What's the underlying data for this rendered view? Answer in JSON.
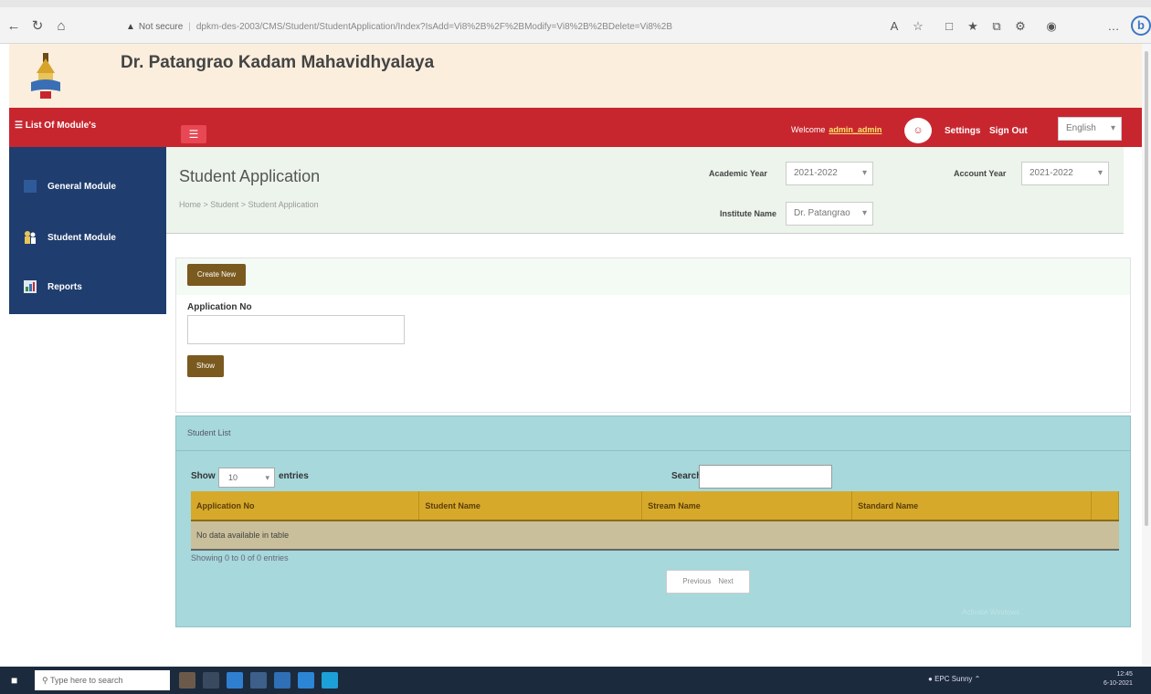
{
  "browser": {
    "not_secure": "Not secure",
    "url": "dpkm-des-2003/CMS/Student/StudentApplication/Index?IsAdd=Vi8%2B%2F%2BModify=Vi8%2B%2BDelete=Vi8%2B"
  },
  "site": {
    "title": "Dr. Patangrao Kadam Mahavidhyalaya"
  },
  "topnav": {
    "module_list": "List Of Module's",
    "welcome": "Welcome",
    "username": "admin_admin",
    "settings": "Settings",
    "sign_out": "Sign Out",
    "language": "English"
  },
  "sidebar": {
    "items": [
      {
        "label": "General Module"
      },
      {
        "label": "Student Module"
      },
      {
        "label": "Reports"
      }
    ]
  },
  "header": {
    "title": "Student Application",
    "breadcrumb": "Home > Student > Student Application",
    "academic_year_label": "Academic Year",
    "academic_year_value": "2021-2022",
    "account_year_label": "Account Year",
    "account_year_value": "2021-2022",
    "institute_label": "Institute Name",
    "institute_value": "Dr. Patangrao"
  },
  "form": {
    "create_new": "Create New",
    "application_no_label": "Application No",
    "application_no_value": "",
    "show_button": "Show"
  },
  "list": {
    "title": "Student List",
    "show_label": "Show",
    "page_size": "10",
    "entries_label": "entries",
    "search_label": "Search:",
    "columns": [
      "Application No",
      "Student Name",
      "Stream Name",
      "Standard Name"
    ],
    "empty_message": "No data available in table",
    "showing": "Showing 0 to 0 of 0 entries",
    "previous": "Previous",
    "next": "Next",
    "watermark": "Activate Windows"
  },
  "taskbar": {
    "search_placeholder": "Type here to search",
    "tray_text": "EPC Sunny",
    "time": "12:45",
    "date": "6-10-2021"
  },
  "colors": {
    "red_bar": "#c8262f",
    "sidebar": "#1f3d6e",
    "header_bg": "#fbeedd",
    "table_header": "#d6a92a",
    "list_panel": "#a6d8dc",
    "olive_button": "#7b5a1f"
  }
}
